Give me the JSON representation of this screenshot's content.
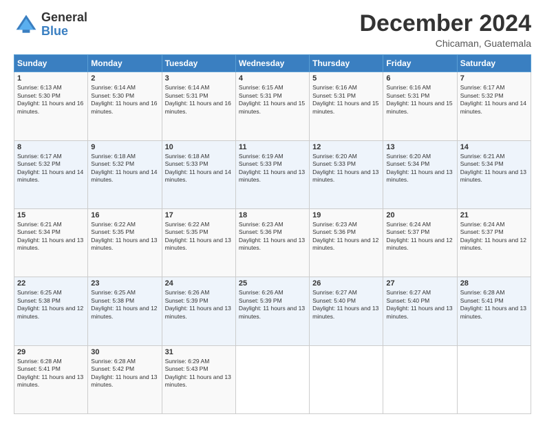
{
  "logo": {
    "general": "General",
    "blue": "Blue"
  },
  "title": "December 2024",
  "location": "Chicaman, Guatemala",
  "days_of_week": [
    "Sunday",
    "Monday",
    "Tuesday",
    "Wednesday",
    "Thursday",
    "Friday",
    "Saturday"
  ],
  "weeks": [
    [
      {
        "day": "1",
        "sunrise": "6:13 AM",
        "sunset": "5:30 PM",
        "daylight": "11 hours and 16 minutes."
      },
      {
        "day": "2",
        "sunrise": "6:14 AM",
        "sunset": "5:30 PM",
        "daylight": "11 hours and 16 minutes."
      },
      {
        "day": "3",
        "sunrise": "6:14 AM",
        "sunset": "5:31 PM",
        "daylight": "11 hours and 16 minutes."
      },
      {
        "day": "4",
        "sunrise": "6:15 AM",
        "sunset": "5:31 PM",
        "daylight": "11 hours and 15 minutes."
      },
      {
        "day": "5",
        "sunrise": "6:16 AM",
        "sunset": "5:31 PM",
        "daylight": "11 hours and 15 minutes."
      },
      {
        "day": "6",
        "sunrise": "6:16 AM",
        "sunset": "5:31 PM",
        "daylight": "11 hours and 15 minutes."
      },
      {
        "day": "7",
        "sunrise": "6:17 AM",
        "sunset": "5:32 PM",
        "daylight": "11 hours and 14 minutes."
      }
    ],
    [
      {
        "day": "8",
        "sunrise": "6:17 AM",
        "sunset": "5:32 PM",
        "daylight": "11 hours and 14 minutes."
      },
      {
        "day": "9",
        "sunrise": "6:18 AM",
        "sunset": "5:32 PM",
        "daylight": "11 hours and 14 minutes."
      },
      {
        "day": "10",
        "sunrise": "6:18 AM",
        "sunset": "5:33 PM",
        "daylight": "11 hours and 14 minutes."
      },
      {
        "day": "11",
        "sunrise": "6:19 AM",
        "sunset": "5:33 PM",
        "daylight": "11 hours and 13 minutes."
      },
      {
        "day": "12",
        "sunrise": "6:20 AM",
        "sunset": "5:33 PM",
        "daylight": "11 hours and 13 minutes."
      },
      {
        "day": "13",
        "sunrise": "6:20 AM",
        "sunset": "5:34 PM",
        "daylight": "11 hours and 13 minutes."
      },
      {
        "day": "14",
        "sunrise": "6:21 AM",
        "sunset": "5:34 PM",
        "daylight": "11 hours and 13 minutes."
      }
    ],
    [
      {
        "day": "15",
        "sunrise": "6:21 AM",
        "sunset": "5:34 PM",
        "daylight": "11 hours and 13 minutes."
      },
      {
        "day": "16",
        "sunrise": "6:22 AM",
        "sunset": "5:35 PM",
        "daylight": "11 hours and 13 minutes."
      },
      {
        "day": "17",
        "sunrise": "6:22 AM",
        "sunset": "5:35 PM",
        "daylight": "11 hours and 13 minutes."
      },
      {
        "day": "18",
        "sunrise": "6:23 AM",
        "sunset": "5:36 PM",
        "daylight": "11 hours and 13 minutes."
      },
      {
        "day": "19",
        "sunrise": "6:23 AM",
        "sunset": "5:36 PM",
        "daylight": "11 hours and 12 minutes."
      },
      {
        "day": "20",
        "sunrise": "6:24 AM",
        "sunset": "5:37 PM",
        "daylight": "11 hours and 12 minutes."
      },
      {
        "day": "21",
        "sunrise": "6:24 AM",
        "sunset": "5:37 PM",
        "daylight": "11 hours and 12 minutes."
      }
    ],
    [
      {
        "day": "22",
        "sunrise": "6:25 AM",
        "sunset": "5:38 PM",
        "daylight": "11 hours and 12 minutes."
      },
      {
        "day": "23",
        "sunrise": "6:25 AM",
        "sunset": "5:38 PM",
        "daylight": "11 hours and 12 minutes."
      },
      {
        "day": "24",
        "sunrise": "6:26 AM",
        "sunset": "5:39 PM",
        "daylight": "11 hours and 13 minutes."
      },
      {
        "day": "25",
        "sunrise": "6:26 AM",
        "sunset": "5:39 PM",
        "daylight": "11 hours and 13 minutes."
      },
      {
        "day": "26",
        "sunrise": "6:27 AM",
        "sunset": "5:40 PM",
        "daylight": "11 hours and 13 minutes."
      },
      {
        "day": "27",
        "sunrise": "6:27 AM",
        "sunset": "5:40 PM",
        "daylight": "11 hours and 13 minutes."
      },
      {
        "day": "28",
        "sunrise": "6:28 AM",
        "sunset": "5:41 PM",
        "daylight": "11 hours and 13 minutes."
      }
    ],
    [
      {
        "day": "29",
        "sunrise": "6:28 AM",
        "sunset": "5:41 PM",
        "daylight": "11 hours and 13 minutes."
      },
      {
        "day": "30",
        "sunrise": "6:28 AM",
        "sunset": "5:42 PM",
        "daylight": "11 hours and 13 minutes."
      },
      {
        "day": "31",
        "sunrise": "6:29 AM",
        "sunset": "5:43 PM",
        "daylight": "11 hours and 13 minutes."
      },
      null,
      null,
      null,
      null
    ]
  ]
}
